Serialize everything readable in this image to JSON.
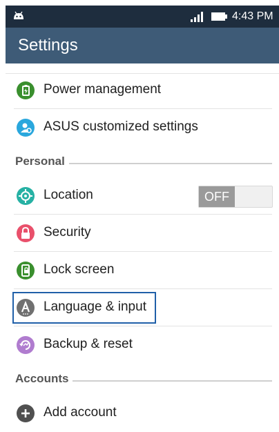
{
  "status_bar": {
    "time": "4:43 PM",
    "icons": [
      "android-icon",
      "signal-icon",
      "battery-icon"
    ]
  },
  "action_bar": {
    "title": "Settings"
  },
  "items_top": [
    {
      "label": "Power management",
      "icon": "power-management-icon",
      "color": "#3a8f2e"
    },
    {
      "label": "ASUS customized settings",
      "icon": "asus-settings-icon",
      "color": "#2aa7dd"
    }
  ],
  "personal": {
    "header": "Personal",
    "items": [
      {
        "label": "Location",
        "icon": "location-icon",
        "color": "#26b1a4",
        "toggle": "OFF"
      },
      {
        "label": "Security",
        "icon": "lock-icon",
        "color": "#e9506b"
      },
      {
        "label": "Lock screen",
        "icon": "lock-screen-icon",
        "color": "#3a8f2e"
      },
      {
        "label": "Language & input",
        "icon": "language-icon",
        "color": "#707070"
      },
      {
        "label": "Backup & reset",
        "icon": "backup-icon",
        "color": "#b07ccf"
      }
    ]
  },
  "accounts": {
    "header": "Accounts",
    "items": [
      {
        "label": "Add account",
        "icon": "add-account-icon",
        "color": "#505050"
      }
    ]
  }
}
